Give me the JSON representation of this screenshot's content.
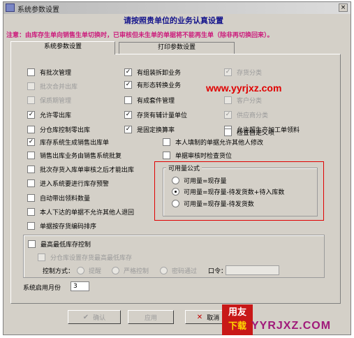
{
  "window": {
    "title": "系统参数设置",
    "close_glyph": "×"
  },
  "heading": "请按照贵单位的业务认真设置",
  "notice": "注意：由库存生单向销售生单切换时，已审核但未生单的单据将不能再生单（除非再切换回来）。",
  "tabs": {
    "active": "系统参数设置",
    "inactive": "打印参数设置"
  },
  "checkboxes": {
    "batch": {
      "label": "有批次管理",
      "checked": false
    },
    "batch_merge": {
      "label": "批次合并出库",
      "checked": false
    },
    "shelf_life": {
      "label": "保质期管理",
      "checked": false
    },
    "allow_zero_out": {
      "label": "允许零出库",
      "checked": true
    },
    "warehouse_sales": {
      "label": "分仓库控制零出库",
      "checked": false
    },
    "stock_gen_sales": {
      "label": "库存系统生成销售出库单",
      "checked": true
    },
    "sales_gen_by_sales": {
      "label": "销售出库业务由销售系统批复",
      "checked": false
    },
    "batch_stock_audit": {
      "label": "批次存货入库单审核之后才能出库",
      "checked": false
    },
    "warn": {
      "label": "进入系统要进行库存预警",
      "checked": false
    },
    "auto_carry_qty": {
      "label": "自动带出领料数量",
      "checked": false
    },
    "no_self_return": {
      "label": "本人下达的单据不允许其他人退回",
      "checked": false
    },
    "sort_by_code": {
      "label": "单据按存货编码排序",
      "checked": false
    },
    "assembly": {
      "label": "有组装拆卸业务",
      "checked": true
    },
    "form_change": {
      "label": "有形态转换业务",
      "checked": true
    },
    "consign": {
      "label": "有成套件管理",
      "checked": false
    },
    "aux_unit": {
      "label": "存货有辅计量单位",
      "checked": true
    },
    "fixed_rate": {
      "label": "是固定换算率",
      "checked": true
    },
    "others_modify": {
      "label": "本人填制的单据允许其他人修改",
      "checked": false
    },
    "check_location": {
      "label": "单据审核时检查货位",
      "checked": false
    },
    "stock_class": {
      "label": "存货分类",
      "checked": true
    },
    "customer_class": {
      "label": "客户分类",
      "checked": false
    },
    "supplier_class": {
      "label": "供应商分类",
      "checked": true
    },
    "over_production": {
      "label": "允许超生产加工单领料",
      "checked": false
    },
    "check_custom": {
      "label": "检查自定义项",
      "checked": false
    }
  },
  "available_formula": {
    "title": "可用量公式",
    "options": [
      {
        "label": "可用量=现存量",
        "selected": false
      },
      {
        "label": "可用量=现存量-待发货数+待入库数",
        "selected": true
      },
      {
        "label": "可用量=现存量-待发货数",
        "selected": false
      }
    ]
  },
  "max_min_stock": {
    "label": "最高最低库存控制",
    "checked": false,
    "by_warehouse": {
      "label": "分仓库设置存货最高最低库存",
      "checked": false
    },
    "control_mode_label": "控制方式：",
    "modes": [
      {
        "label": "提醒",
        "selected": true
      },
      {
        "label": "严格控制",
        "selected": false
      },
      {
        "label": "密码通过",
        "selected": false
      }
    ],
    "password_label": "口令：",
    "password_value": ""
  },
  "start_month": {
    "label": "系统启用月份",
    "value": "3"
  },
  "buttons": {
    "confirm": "确认",
    "apply": "应用",
    "cancel": "取消"
  },
  "watermarks": {
    "site1": "www.yyrjxz.com",
    "logo_top": "用友",
    "logo_bottom": "下载",
    "site2": "YYRJXZ.COM"
  }
}
